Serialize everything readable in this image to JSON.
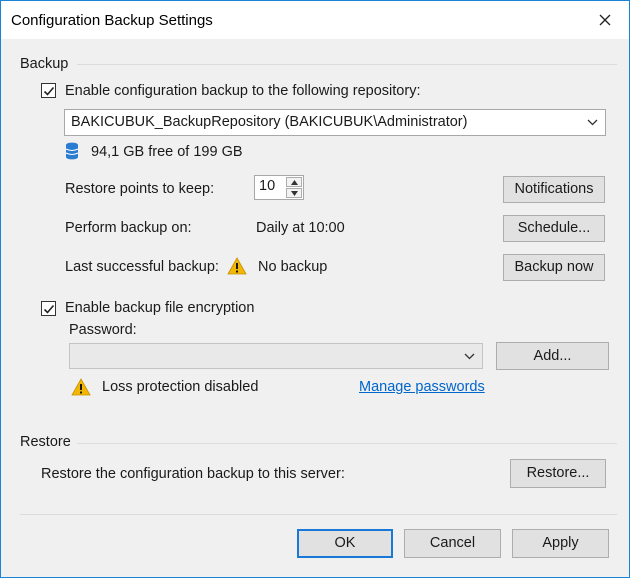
{
  "window": {
    "title": "Configuration Backup Settings"
  },
  "backup": {
    "section_label": "Backup",
    "enable_label": "Enable configuration backup to the following repository:",
    "enable_checked": true,
    "repository": "BAKICUBUK_BackupRepository (BAKICUBUK\\Administrator)",
    "free_space": "94,1 GB free of 199 GB",
    "restore_points_label": "Restore points to keep:",
    "restore_points_value": "10",
    "perform_backup_label": "Perform backup on:",
    "perform_backup_value": "Daily at 10:00",
    "last_backup_label": "Last successful backup:",
    "last_backup_value": "No backup",
    "notifications_button": "Notifications",
    "schedule_button": "Schedule...",
    "backup_now_button": "Backup now"
  },
  "encryption": {
    "enable_label": "Enable backup file encryption",
    "enable_checked": true,
    "password_label": "Password:",
    "password_value": "",
    "add_button": "Add...",
    "loss_protection": "Loss protection disabled",
    "manage_link": "Manage passwords"
  },
  "restore": {
    "section_label": "Restore",
    "description": "Restore the configuration backup to this server:",
    "restore_button": "Restore..."
  },
  "footer": {
    "ok_button": "OK",
    "cancel_button": "Cancel",
    "apply_button": "Apply"
  },
  "colors": {
    "accent": "#1a78d6",
    "link": "#0066cc",
    "warning": "#f2b705"
  }
}
